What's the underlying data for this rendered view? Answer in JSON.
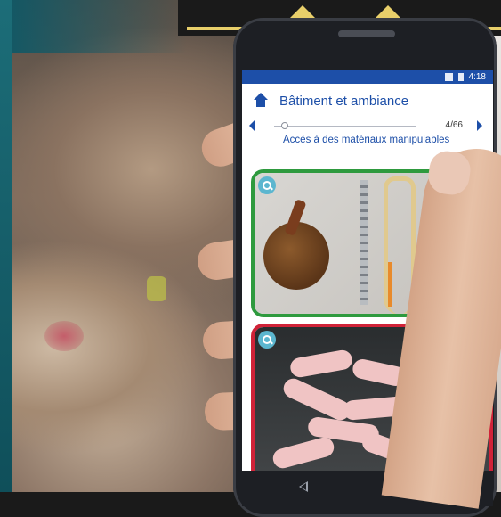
{
  "status_bar": {
    "time": "4:18",
    "icons": [
      "signal-icon",
      "battery-icon"
    ]
  },
  "app": {
    "title": "Bâtiment et ambiance",
    "pager": {
      "counter": "4/66"
    },
    "subtitle": "Accès à des matériaux manipulables"
  },
  "colors": {
    "primary": "#1d4fa8",
    "good_card_border": "#2e9a3e",
    "bad_card_border": "#d02238",
    "zoom_button": "#5cb6cf"
  }
}
